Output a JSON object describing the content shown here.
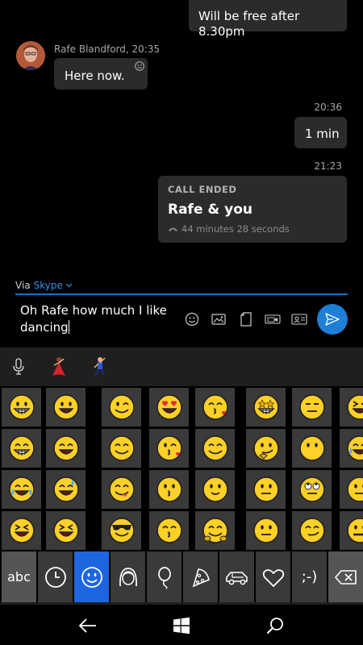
{
  "conversation": {
    "messages": [
      {
        "id": "top",
        "text": "Will be free after 8.30pm",
        "direction": "outgoing"
      },
      {
        "id": "here",
        "sender": "Rafe Blandford, 20:35",
        "text": "Here now.",
        "direction": "incoming"
      },
      {
        "id": "min",
        "timestamp": "20:36",
        "text": "1 min",
        "direction": "outgoing"
      }
    ],
    "call": {
      "timestamp": "21:23",
      "title": "CALL ENDED",
      "participants": "Rafe & you",
      "duration": "44 minutes 28 seconds"
    }
  },
  "compose": {
    "via_label": "Via",
    "via_service": "Skype",
    "text": "Oh Rafe how much I like dancing",
    "accent_color": "#1e7fd6",
    "tools": [
      "emoji-icon",
      "image-icon",
      "file-icon",
      "video-message-icon",
      "contact-card-icon"
    ],
    "send": "send-icon"
  },
  "keyboard": {
    "suggestions": [
      "microphone-icon",
      "dancing-woman-emoji",
      "dancing-man-emoji"
    ],
    "emoji_rows": [
      [
        "grinning",
        "smile",
        "wink",
        "heart-eyes",
        "blush-kiss",
        "star-eyes",
        "expressionless",
        "squint-tongue"
      ],
      [
        "grin",
        "grinning-open",
        "smiling",
        "kiss-heart",
        "relaxed",
        "thinking",
        "no-mouth",
        "crying"
      ],
      [
        "tears-of-joy",
        "sweat-smile",
        "yum",
        "kissing",
        "slight-smile",
        "raised-eyebrow",
        "rolling-eyes",
        "neutral-partial"
      ],
      [
        "rofl",
        "laughing-squint",
        "sunglasses",
        "kissing-smile",
        "hugging",
        "neutral",
        "smirk",
        "zipper"
      ]
    ],
    "category_bar": {
      "abc_label": "abc",
      "symbols_label": ";-)",
      "categories": [
        "recent-icon",
        "smileys-icon",
        "people-icon",
        "balloon-icon",
        "food-icon",
        "car-icon",
        "heart-icon",
        "emoticon-text",
        "backspace-icon"
      ],
      "active": "smileys-icon"
    }
  },
  "navigation": [
    "back-icon",
    "windows-icon",
    "search-icon"
  ]
}
